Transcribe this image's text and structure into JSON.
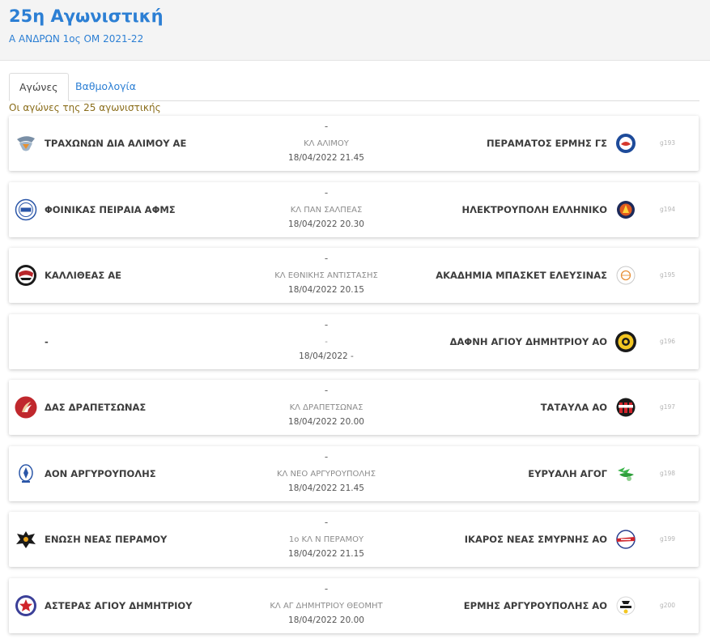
{
  "header": {
    "title": "25η Αγωνιστική",
    "subtitle": "Α ΑΝΔΡΩΝ 1ος ΟΜ 2021-22"
  },
  "tabs": [
    {
      "label": "Αγώνες"
    },
    {
      "label": "Βαθμολογία"
    }
  ],
  "caption": "Οι αγώνες της 25 αγωνιστικής",
  "matches": [
    {
      "home": "ΤΡΑΧΩΝΩΝ ΔΙΑ ΑΛΙΜΟΥ ΑΕ",
      "score": "-",
      "venue": "ΚΛ ΑΛΙΜΟΥ",
      "datetime": "18/04/2022 21.45",
      "away": "ΠΕΡΑΜΑΤΟΣ ΕΡΜΗΣ ΓΣ",
      "code": "g193"
    },
    {
      "home": "ΦΟΙΝΙΚΑΣ ΠΕΙΡΑΙΑ ΑΦΜΣ",
      "score": "-",
      "venue": "ΚΛ ΠΑΝ ΣΑΛΠΕΑΣ",
      "datetime": "18/04/2022 20.30",
      "away": "ΗΛΕΚΤΡΟΥΠΟΛΗ ΕΛΛΗΝΙΚΟ",
      "code": "g194"
    },
    {
      "home": "ΚΑΛΛΙΘΕΑΣ ΑΕ",
      "score": "-",
      "venue": "ΚΛ ΕΘΝΙΚΗΣ ΑΝΤΙΣΤΑΣΗΣ",
      "datetime": "18/04/2022 20.15",
      "away": "ΑΚΑΔΗΜΙΑ ΜΠΑΣΚΕΤ ΕΛΕΥΣΙΝΑΣ",
      "code": "g195"
    },
    {
      "home": "-",
      "score": "-",
      "venue": "-",
      "datetime": "18/04/2022 -",
      "away": "ΔΑΦΝΗ ΑΓΙΟΥ ΔΗΜΗΤΡΙΟΥ ΑΟ",
      "code": "g196"
    },
    {
      "home": "ΔΑΣ ΔΡΑΠΕΤΣΩΝΑΣ",
      "score": "-",
      "venue": "ΚΛ ΔΡΑΠΕΤΣΩΝΑΣ",
      "datetime": "18/04/2022 20.00",
      "away": "ΤΑΤΑΥΛΑ ΑΟ",
      "code": "g197"
    },
    {
      "home": "ΑΟΝ ΑΡΓΥΡΟΥΠΟΛΗΣ",
      "score": "-",
      "venue": "ΚΛ ΝΕΟ ΑΡΓΥΡΟΥΠΟΛΗΣ",
      "datetime": "18/04/2022 21.45",
      "away": "ΕΥΡΥΑΛΗ ΑΓΟΓ",
      "code": "g198"
    },
    {
      "home": "ΕΝΩΣΗ ΝΕΑΣ ΠΕΡΑΜΟΥ",
      "score": "-",
      "venue": "1ο ΚΛ Ν ΠΕΡΑΜΟΥ",
      "datetime": "18/04/2022 21.15",
      "away": "ΙΚΑΡΟΣ ΝΕΑΣ ΣΜΥΡΝΗΣ ΑΟ",
      "code": "g199"
    },
    {
      "home": "ΑΣΤΕΡΑΣ ΑΓΙΟΥ ΔΗΜΗΤΡΙΟΥ",
      "score": "-",
      "venue": "ΚΛ ΑΓ ΔΗΜΗΤΡΙΟΥ ΘΕΟΜΗΤ",
      "datetime": "18/04/2022 20.00",
      "away": "ΕΡΜΗΣ ΑΡΓΥΡΟΥΠΟΛΗΣ ΑΟ",
      "code": "g200"
    }
  ]
}
